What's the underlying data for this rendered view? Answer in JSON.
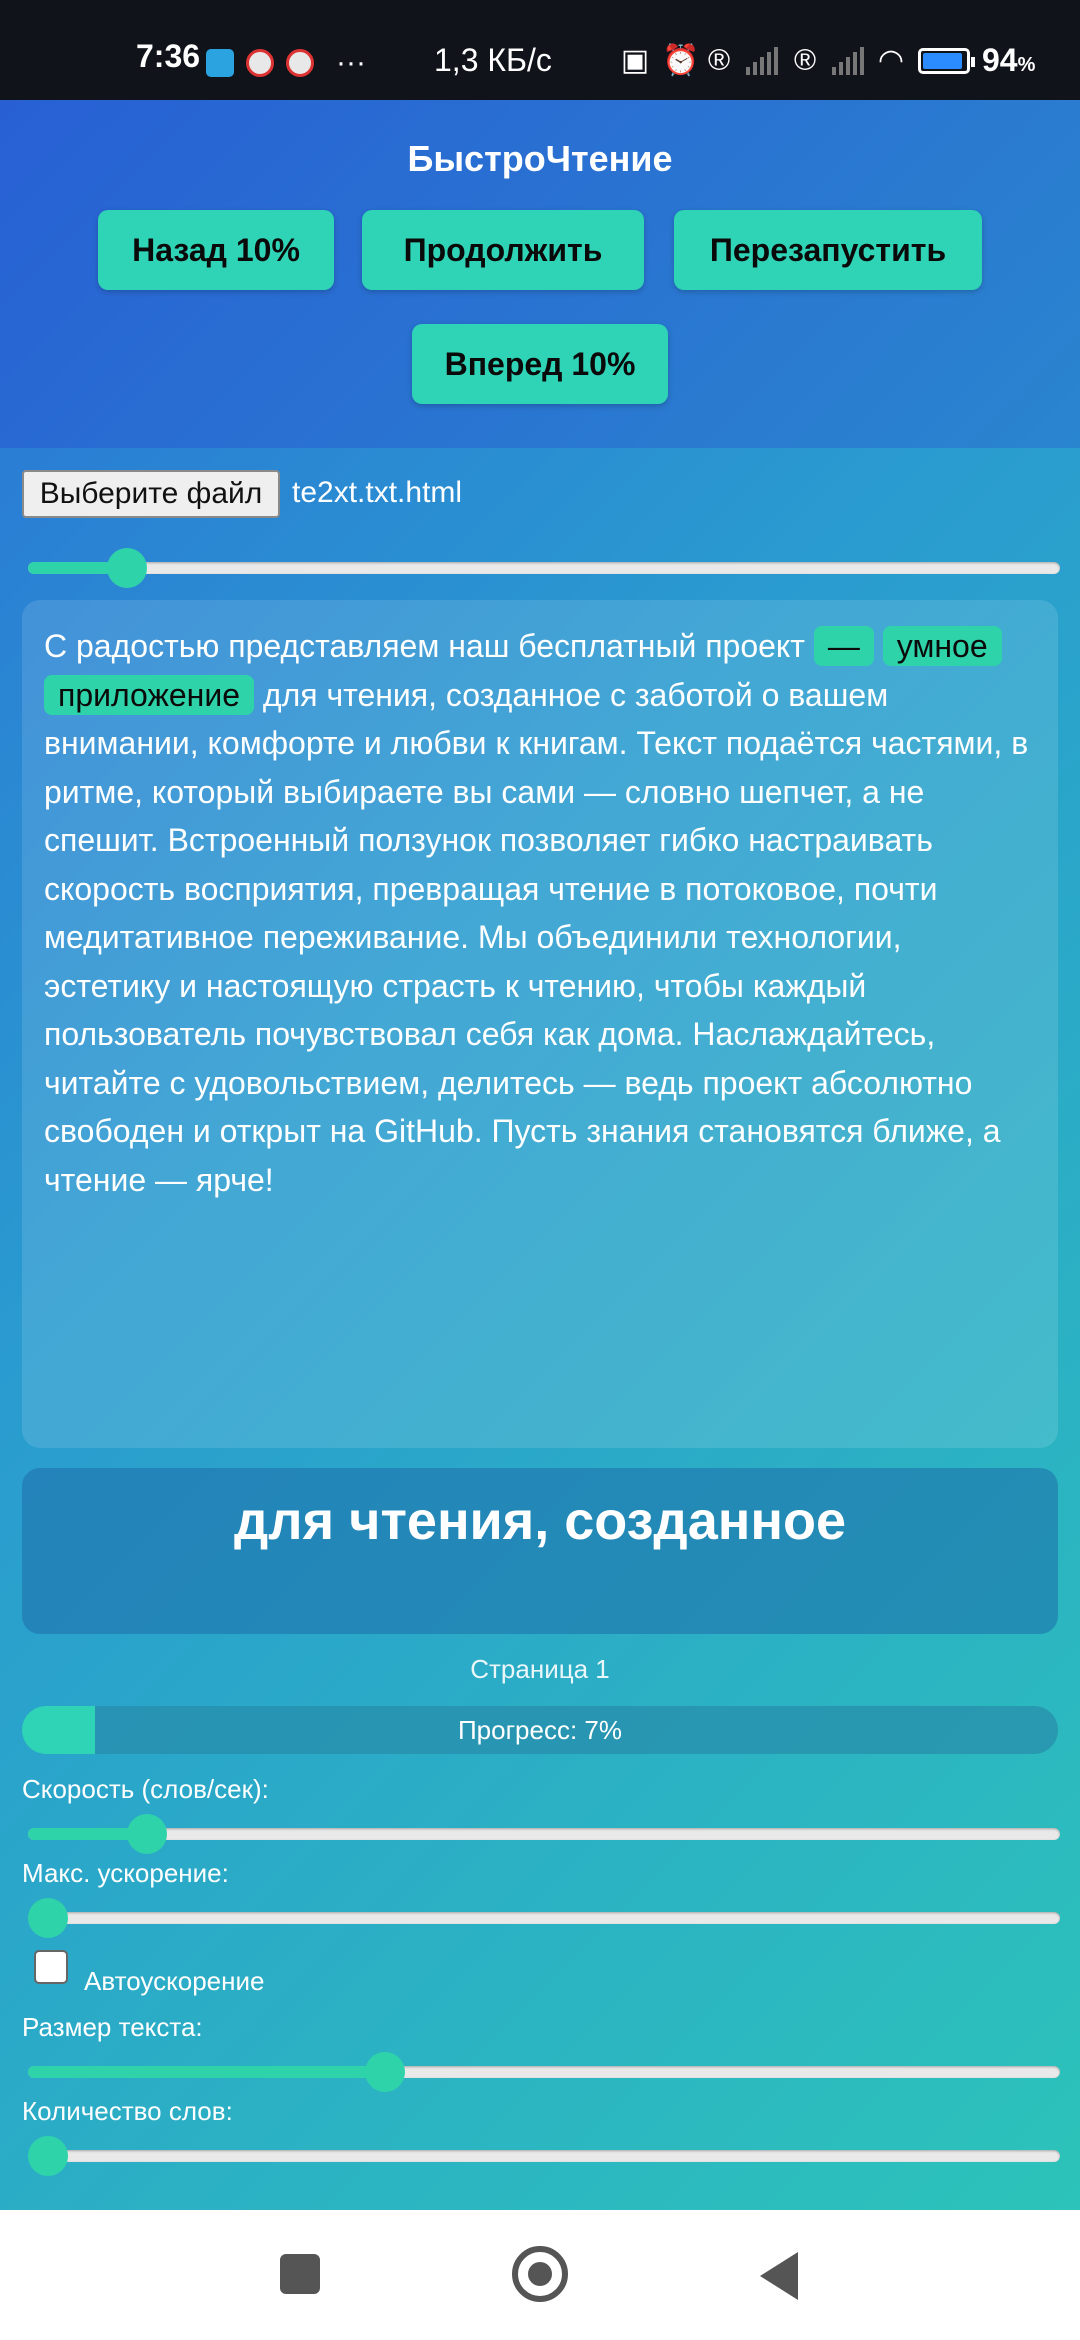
{
  "status_bar": {
    "time": "7:36",
    "more": "···",
    "net_speed": "1,3 КБ/с",
    "battery": "94",
    "battery_unit": "%",
    "battery_level": 0.94
  },
  "app": {
    "title": "БыстроЧтение",
    "buttons": {
      "back": "Назад 10%",
      "continue": "Продолжить",
      "restart": "Перезапустить",
      "forward": "Вперед 10%"
    }
  },
  "file": {
    "choose_label": "Выберите файл",
    "file_name": "te2xt.txt.html"
  },
  "position_slider": {
    "value": 0.08
  },
  "text": {
    "before": "С радостью представляем наш бесплатный проект ",
    "highlight_1": "—",
    "highlight_2": "умное",
    "highlight_3": "приложение",
    "after": " для чтения, созданное с заботой о вашем внимании, комфорте и любви к книгам. Текст подаётся частями, в ритме, который выбираете вы сами — словно шепчет, а не спешит. Встроенный ползунок позволяет гибко настраивать скорость восприятия, превращая чтение в потоковое, почти медитативное переживание. Мы объединили технологии, эстетику и настоящую страсть к чтению, чтобы каждый пользователь почувствовал себя как дома. Наслаждайтесь, читайте с удовольствием, делитесь — ведь проект абсолютно свободен и открыт на GitHub. Пусть знания становятся ближе, а чтение — ярче!"
  },
  "current_word": "для чтения, созданное",
  "page_label": "Страница 1",
  "progress": {
    "label": "Прогресс: 7%",
    "value": 0.07
  },
  "controls": {
    "speed_label": "Скорость (слов/сек):",
    "speed_value": 0.1,
    "max_accel_label": "Макс. ускорение:",
    "max_accel_value": 0.0,
    "auto_accel_label": "Автоускорение",
    "auto_accel_checked": false,
    "text_size_label": "Размер текста:",
    "text_size_value": 0.34,
    "word_count_label": "Количество слов:",
    "word_count_value": 0.0
  },
  "colors": {
    "accent": "#2fd3b6",
    "header_bg": "#2860d4"
  }
}
